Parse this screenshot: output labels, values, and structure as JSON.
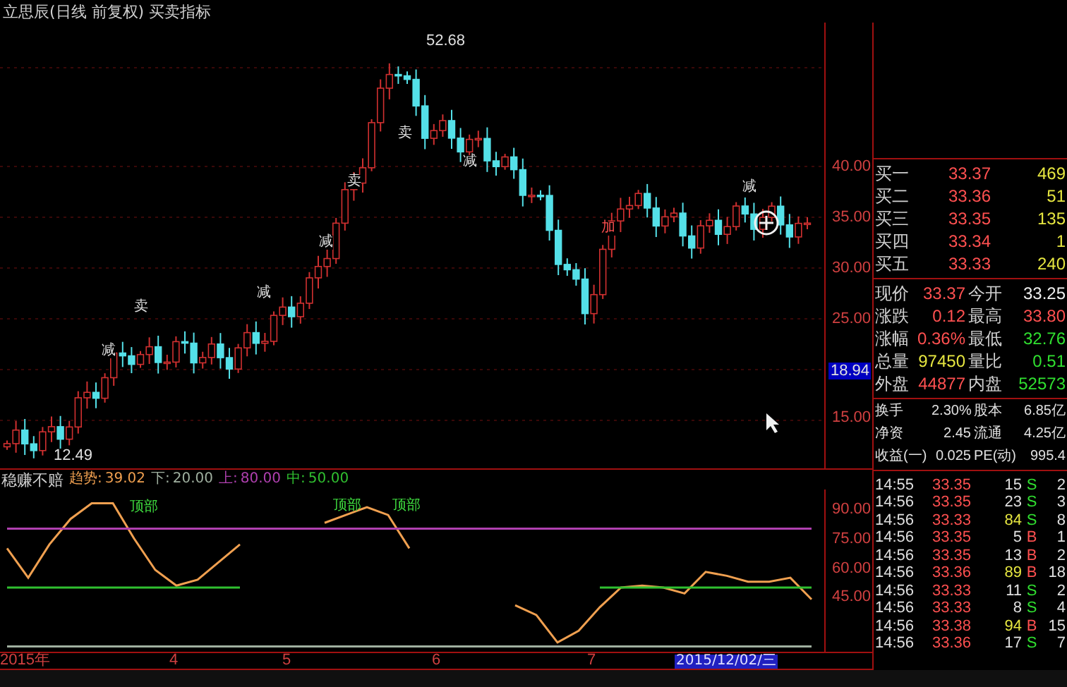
{
  "title": "立思辰(日线 前复权) 买卖指标",
  "price_chart": {
    "high_label": "52.68",
    "low_label": "12.49",
    "axis_labels": [
      "40.00",
      "35.00",
      "30.00",
      "25.00",
      "15.00"
    ],
    "current_marker": "18.94",
    "signals": [
      {
        "text": "卖",
        "color": "#e0e0e0"
      },
      {
        "text": "减",
        "color": "#e0e0e0"
      },
      {
        "text": "减",
        "color": "#e0e0e0"
      },
      {
        "text": "卖",
        "color": "#e0e0e0"
      },
      {
        "text": "减",
        "color": "#e0e0e0"
      },
      {
        "text": "卖",
        "color": "#e0e0e0"
      },
      {
        "text": "减",
        "color": "#e0e0e0"
      },
      {
        "text": "加",
        "color": "#ff5050"
      },
      {
        "text": "减",
        "color": "#e0e0e0"
      }
    ]
  },
  "indicator": {
    "name": "稳赚不赔",
    "legend": [
      {
        "kind": "series",
        "colon": ":",
        "value": "39.02"
      },
      {
        "kind": "series",
        "colon": ":",
        "value": "20.00"
      },
      {
        "kind": "series",
        "colon": ":",
        "value": "80.00"
      },
      {
        "kind": "series",
        "colon": ":",
        "value": "50.00"
      }
    ],
    "marks": [
      "顶部",
      "顶部",
      "顶部"
    ],
    "chart_data": {
      "type": "line",
      "ylim": [
        18,
        100
      ],
      "yticks": [
        {
          "value": 90,
          "label": "90.00"
        },
        {
          "value": 75,
          "label": "75.00"
        },
        {
          "value": 60,
          "label": "60.00"
        },
        {
          "value": 45,
          "label": "45.00"
        }
      ],
      "series": [
        {
          "name": "趋势",
          "color": "#f0a050",
          "values": [
            70,
            55,
            72,
            85,
            93,
            93,
            75,
            59,
            51,
            54,
            63,
            72,
            null,
            null,
            null,
            83,
            87,
            91,
            87,
            70,
            null,
            null,
            null,
            null,
            41,
            36,
            22,
            28,
            40,
            50,
            51,
            50,
            47,
            58,
            56,
            53,
            53,
            55,
            44
          ]
        },
        {
          "name": "下",
          "color": "#a0b0a0",
          "values": [
            20,
            20,
            20,
            20,
            20,
            20,
            20,
            20,
            20,
            20,
            20,
            20,
            20,
            20,
            20,
            20,
            20,
            20,
            20,
            20,
            20,
            20,
            20,
            20,
            20,
            20,
            20,
            20,
            20,
            20,
            20,
            20,
            20,
            20,
            20,
            20,
            20,
            20,
            20
          ]
        },
        {
          "name": "上",
          "color": "#b040b0",
          "values": [
            80,
            80,
            80,
            80,
            80,
            80,
            80,
            80,
            80,
            80,
            80,
            80,
            80,
            80,
            80,
            80,
            80,
            80,
            80,
            80,
            80,
            80,
            80,
            80,
            80,
            80,
            80,
            80,
            80,
            80,
            80,
            80,
            80,
            80,
            80,
            80,
            80,
            80,
            80
          ]
        },
        {
          "name": "中",
          "color": "#30c030",
          "values": [
            50,
            50,
            50,
            50,
            50,
            50,
            50,
            50,
            50,
            50,
            50,
            50,
            null,
            null,
            null,
            null,
            null,
            null,
            null,
            null,
            null,
            null,
            null,
            null,
            null,
            null,
            null,
            null,
            50,
            50,
            50,
            50,
            50,
            50,
            50,
            50,
            50,
            50,
            50
          ]
        }
      ]
    }
  },
  "x_axis": {
    "labels": [
      "2015年",
      "4",
      "5",
      "6",
      "7"
    ],
    "cursor_date": "2015/12/02/三"
  },
  "bids": [
    {
      "label": "买一",
      "price": "33.37",
      "volume": "469"
    },
    {
      "label": "买二",
      "price": "33.36",
      "volume": "51"
    },
    {
      "label": "买三",
      "price": "33.35",
      "volume": "135"
    },
    {
      "label": "买四",
      "price": "33.34",
      "volume": "1"
    },
    {
      "label": "买五",
      "price": "33.33",
      "volume": "240"
    }
  ],
  "stats": [
    {
      "label": "现价",
      "value": "33.37",
      "color": "#ff5050"
    },
    {
      "label": "今开",
      "value": "33.25",
      "color": "#f0f0f0"
    },
    {
      "label": "涨跌",
      "value": "0.12",
      "color": "#ff5050"
    },
    {
      "label": "最高",
      "value": "33.80",
      "color": "#ff5050"
    },
    {
      "label": "涨幅",
      "value": "0.36%",
      "color": "#ff5050"
    },
    {
      "label": "最低",
      "value": "32.76",
      "color": "#30e030"
    },
    {
      "label": "总量",
      "value": "97450",
      "color": "#e6e640"
    },
    {
      "label": "量比",
      "value": "0.51",
      "color": "#30e030"
    },
    {
      "label": "外盘",
      "value": "44877",
      "color": "#ff5050"
    },
    {
      "label": "内盘",
      "value": "52573",
      "color": "#30e030"
    }
  ],
  "fundamentals": [
    {
      "label": "换手",
      "value": "2.30%"
    },
    {
      "label": "股本",
      "value": "6.85亿"
    },
    {
      "label": "净资",
      "value": "2.45"
    },
    {
      "label": "流通",
      "value": "4.25亿"
    },
    {
      "label": "收益(一)",
      "value": "0.025"
    },
    {
      "label": "PE(动)",
      "value": "995.4"
    }
  ],
  "trades": [
    {
      "time": "14:55",
      "price": "33.35",
      "volume": "15",
      "large": false,
      "side": "S",
      "color": "#30e030",
      "count": "2"
    },
    {
      "time": "14:56",
      "price": "33.35",
      "volume": "23",
      "large": false,
      "side": "S",
      "color": "#30e030",
      "count": "3"
    },
    {
      "time": "14:56",
      "price": "33.33",
      "volume": "84",
      "large": true,
      "side": "S",
      "color": "#30e030",
      "count": "8"
    },
    {
      "time": "14:56",
      "price": "33.35",
      "volume": "5",
      "large": false,
      "side": "B",
      "color": "#ff5050",
      "count": "1"
    },
    {
      "time": "14:56",
      "price": "33.35",
      "volume": "13",
      "large": false,
      "side": "B",
      "color": "#ff5050",
      "count": "2"
    },
    {
      "time": "14:56",
      "price": "33.36",
      "volume": "89",
      "large": true,
      "side": "B",
      "color": "#ff5050",
      "count": "18"
    },
    {
      "time": "14:56",
      "price": "33.33",
      "volume": "11",
      "large": false,
      "side": "S",
      "color": "#30e030",
      "count": "2"
    },
    {
      "time": "14:56",
      "price": "33.33",
      "volume": "8",
      "large": false,
      "side": "S",
      "color": "#30e030",
      "count": "4"
    },
    {
      "time": "14:56",
      "price": "33.38",
      "volume": "94",
      "large": true,
      "side": "B",
      "color": "#ff5050",
      "count": "15"
    },
    {
      "time": "14:56",
      "price": "33.36",
      "volume": "17",
      "large": false,
      "side": "S",
      "color": "#30e030",
      "count": "7"
    }
  ]
}
